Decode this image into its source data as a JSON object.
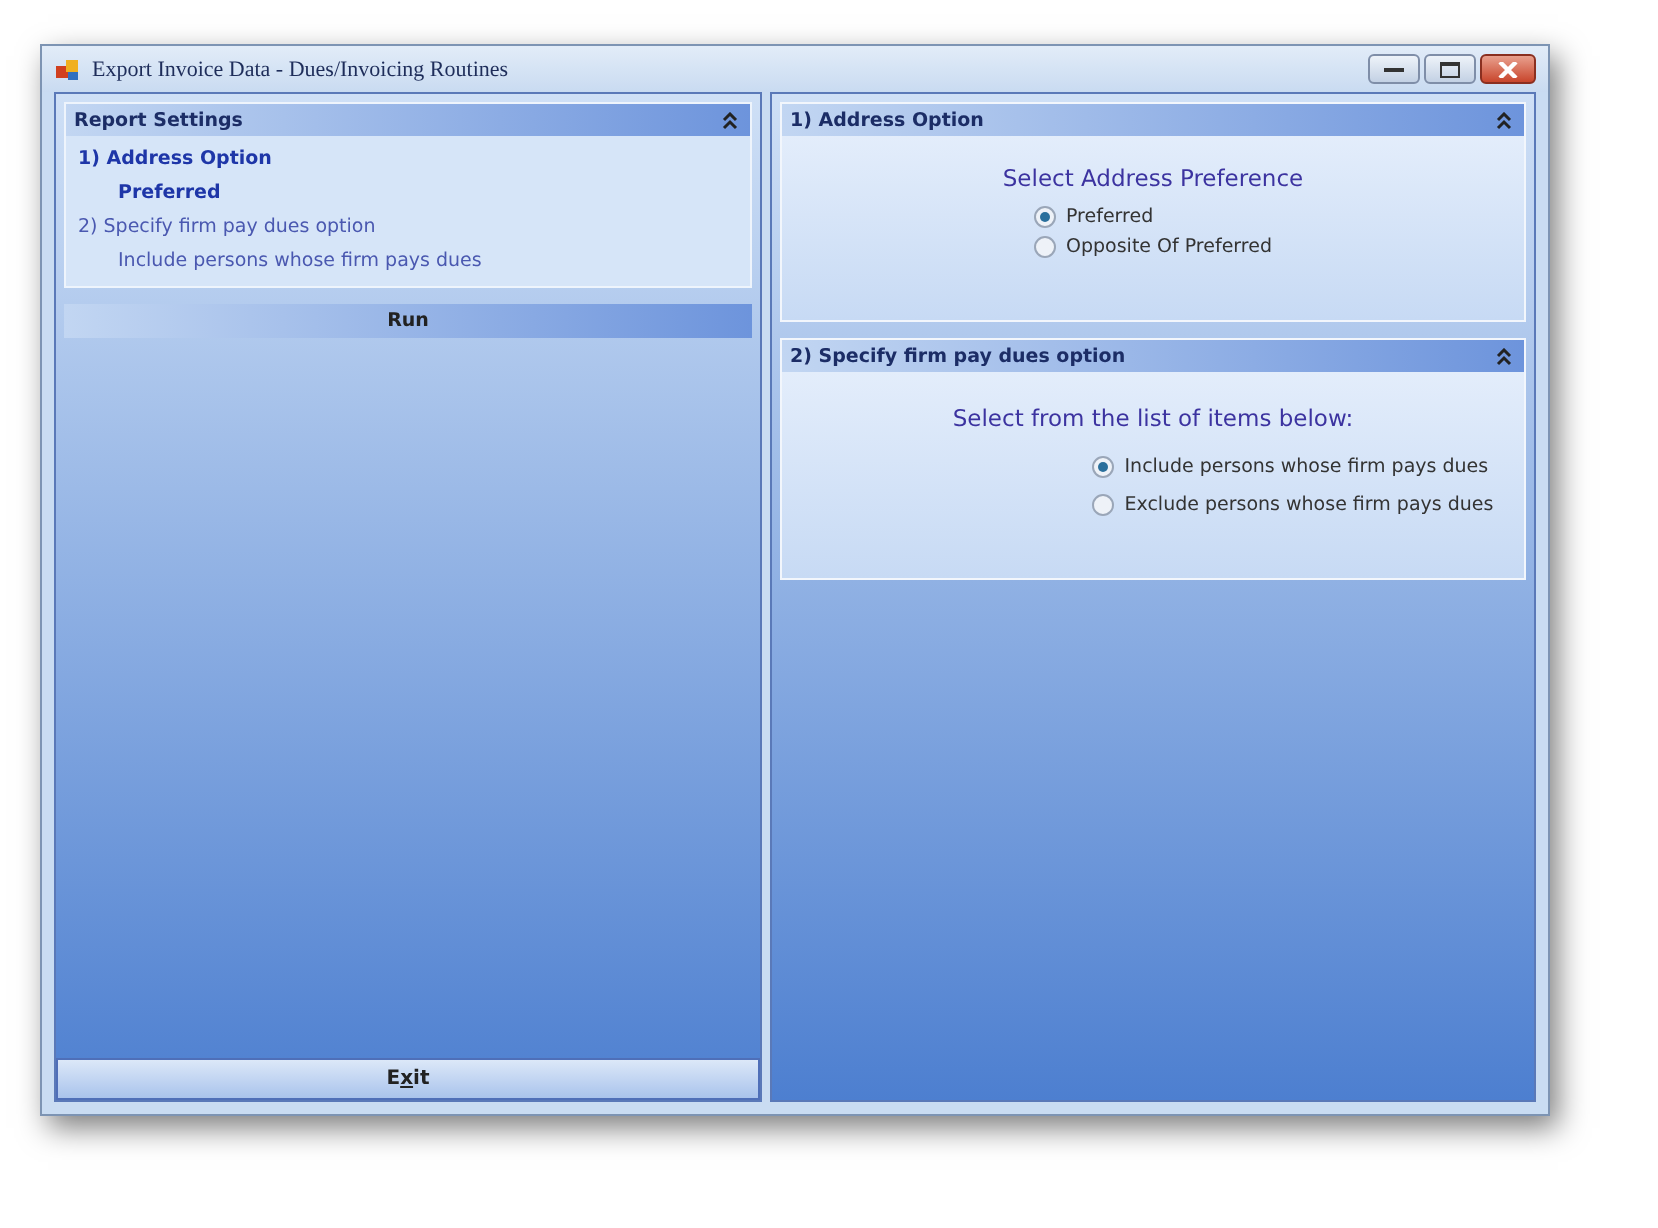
{
  "window": {
    "title": "Export Invoice Data - Dues/Invoicing Routines"
  },
  "report_settings": {
    "title": "Report Settings",
    "items": [
      {
        "label": "1)  Address Option",
        "value": "Preferred",
        "selected": true
      },
      {
        "label": "2)  Specify firm pay dues option",
        "value": "Include persons whose firm pays dues",
        "selected": false
      }
    ]
  },
  "run_button": {
    "label": "Run"
  },
  "exit_button": {
    "label_segments": [
      {
        "text": "E",
        "underlined": false
      },
      {
        "text": "x",
        "underlined": true
      },
      {
        "text": "it",
        "underlined": false
      }
    ]
  },
  "sections": [
    {
      "title": "1)  Address Option",
      "prompt": "Select Address Preference",
      "options": [
        {
          "label": "Preferred",
          "selected": true
        },
        {
          "label": "Opposite Of Preferred",
          "selected": false
        }
      ]
    },
    {
      "title": "2)  Specify firm pay dues option",
      "prompt": "Select from the list of items below:",
      "options": [
        {
          "label": "Include persons whose firm pays dues",
          "selected": true
        },
        {
          "label": "Exclude persons whose firm pays dues",
          "selected": false
        }
      ]
    }
  ]
}
